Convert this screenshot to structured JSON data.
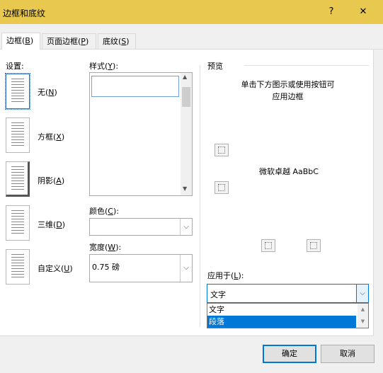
{
  "dialog": {
    "title": "边框和底纹",
    "help": "?",
    "close": "✕"
  },
  "tabs": [
    {
      "label": "边框",
      "key": "B"
    },
    {
      "label": "页面边框",
      "key": "P"
    },
    {
      "label": "底纹",
      "key": "S"
    }
  ],
  "settings": {
    "heading": "设置:",
    "items": [
      {
        "label": "无",
        "key": "N"
      },
      {
        "label": "方框",
        "key": "X"
      },
      {
        "label": "阴影",
        "key": "A"
      },
      {
        "label": "三维",
        "key": "D"
      },
      {
        "label": "自定义",
        "key": "U"
      }
    ]
  },
  "style": {
    "label": "样式",
    "key": "Y"
  },
  "color": {
    "label": "颜色",
    "key": "C",
    "value": ""
  },
  "width": {
    "label": "宽度",
    "key": "W",
    "value": "0.75 磅"
  },
  "preview": {
    "heading": "预览",
    "hint_line1": "单击下方图示或使用按钮可",
    "hint_line2": "应用边框",
    "sample": "微软卓越 AaBbC"
  },
  "apply_to": {
    "label": "应用于",
    "key": "L",
    "value": "文字",
    "options": [
      "文字",
      "段落"
    ],
    "highlighted": "段落"
  },
  "buttons": {
    "ok": "确定",
    "cancel": "取消"
  }
}
